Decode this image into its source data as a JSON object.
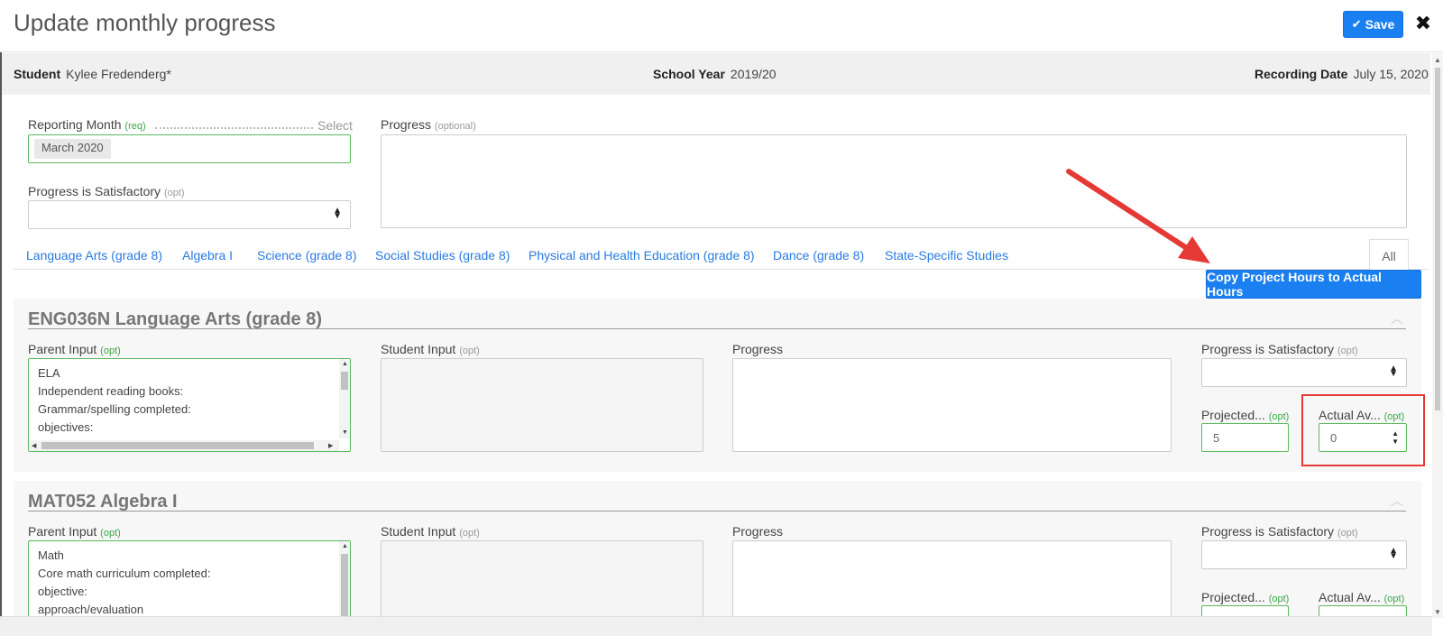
{
  "header": {
    "title": "Update monthly progress",
    "save_label": "Save",
    "save_icon": "✔",
    "close_icon": "✖"
  },
  "info": {
    "student_label": "Student",
    "student_value": "Kylee Fredenderg*",
    "school_year_label": "School Year",
    "school_year_value": "2019/20",
    "recording_date_label": "Recording Date",
    "recording_date_value": "July 15, 2020"
  },
  "form": {
    "reporting_month_label": "Reporting Month",
    "reporting_month_req": "(req)",
    "reporting_month_select": "Select",
    "reporting_month_value": "March 2020",
    "progress_label": "Progress",
    "progress_opt": "(optional)",
    "satisfactory_label": "Progress is Satisfactory",
    "satisfactory_opt": "(opt)"
  },
  "tabs": [
    "Language Arts (grade 8)",
    "Algebra I",
    "Science (grade 8)",
    "Social Studies (grade 8)",
    "Physical and Health Education (grade 8)",
    "Dance (grade 8)",
    "State-Specific Studies"
  ],
  "tab_all": "All",
  "copy_button": "Copy Project Hours to Actual Hours",
  "field_labels": {
    "parent_input": "Parent Input",
    "student_input": "Student Input",
    "progress": "Progress",
    "satisfactory": "Progress is Satisfactory",
    "projected": "Projected...",
    "actual": "Actual Av...",
    "opt": "(opt)"
  },
  "courses": [
    {
      "title": "ENG036N Language Arts (grade 8)",
      "parent_input": "ELA\nIndependent reading books:\nGrammar/spelling completed:\nobjectives:",
      "projected": "5",
      "actual": "0"
    },
    {
      "title": "MAT052 Algebra I",
      "parent_input": "Math\nCore math curriculum completed:\nobjective:\napproach/evaluation",
      "projected": "",
      "actual": ""
    }
  ],
  "colors": {
    "primary": "#1a7ff0",
    "annotation_red": "#e53935",
    "valid_green": "#5cb85c"
  }
}
